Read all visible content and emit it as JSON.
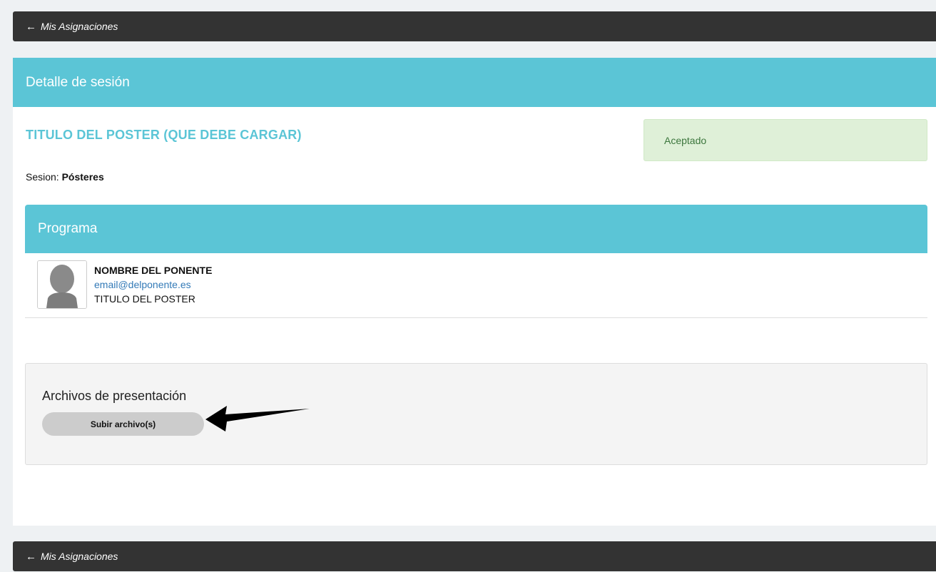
{
  "nav": {
    "back_label": "Mis Asignaciones"
  },
  "card": {
    "header": "Detalle de sesión"
  },
  "poster": {
    "title": "TITULO DEL POSTER (QUE DEBE CARGAR)"
  },
  "status": {
    "label": "Aceptado",
    "color": "#3c763d",
    "background": "#dff0d8"
  },
  "session": {
    "prefix": "Sesion:",
    "name": "Pósteres"
  },
  "programa": {
    "header": "Programa",
    "speaker": {
      "name": "NOMBRE DEL PONENTE",
      "email": "email@delponente.es",
      "poster_title": "TITULO DEL POSTER"
    }
  },
  "files": {
    "title": "Archivos de presentación",
    "upload_label": "Subir archivo(s)"
  },
  "colors": {
    "accent": "#5bc5d6",
    "navbar": "#333333",
    "link": "#337ab7"
  }
}
